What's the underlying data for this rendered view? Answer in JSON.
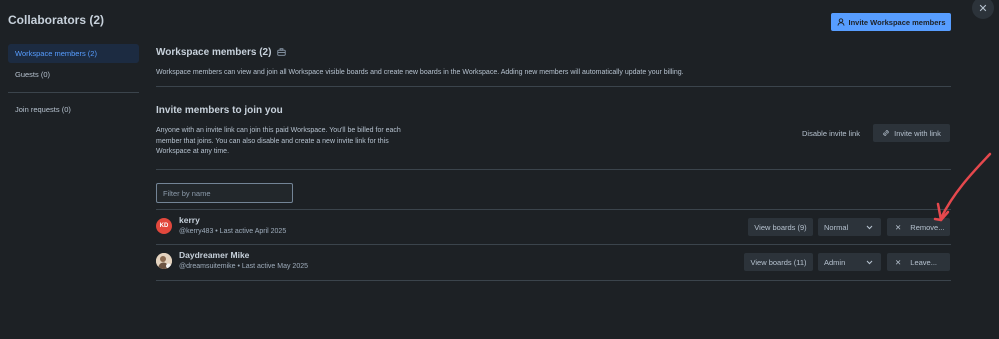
{
  "dialog": {
    "title": "Collaborators (2)",
    "invite_workspace_label": "Invite Workspace members"
  },
  "sidebar": {
    "items": [
      {
        "label": "Workspace members (2)"
      },
      {
        "label": "Guests (0)"
      },
      {
        "label": "Join requests (0)"
      }
    ]
  },
  "members_section": {
    "title": "Workspace members (2)",
    "description": "Workspace members can view and join all Workspace visible boards and create new boards in the Workspace. Adding new members will automatically update your billing."
  },
  "invite_section": {
    "title": "Invite members to join you",
    "description": "Anyone with an invite link can join this paid Workspace. You'll be billed for each member that joins. You can also disable and create a new invite link for this Workspace at any time.",
    "disable_label": "Disable invite link",
    "invite_link_label": "Invite with link"
  },
  "filter": {
    "placeholder": "Filter by name"
  },
  "members": [
    {
      "initials": "KD",
      "name": "kerry",
      "meta": "@kerry483 • Last active April 2025",
      "view_boards": "View boards (9)",
      "role": "Normal",
      "action": "Remove..."
    },
    {
      "name": "Daydreamer Mike",
      "meta": "@dreamsuitemike • Last active May 2025",
      "view_boards": "View boards (11)",
      "role": "Admin",
      "action": "Leave..."
    }
  ],
  "colors": {
    "background": "#1d2125",
    "primary": "#579dff",
    "annotation_arrow": "#e5484d"
  }
}
